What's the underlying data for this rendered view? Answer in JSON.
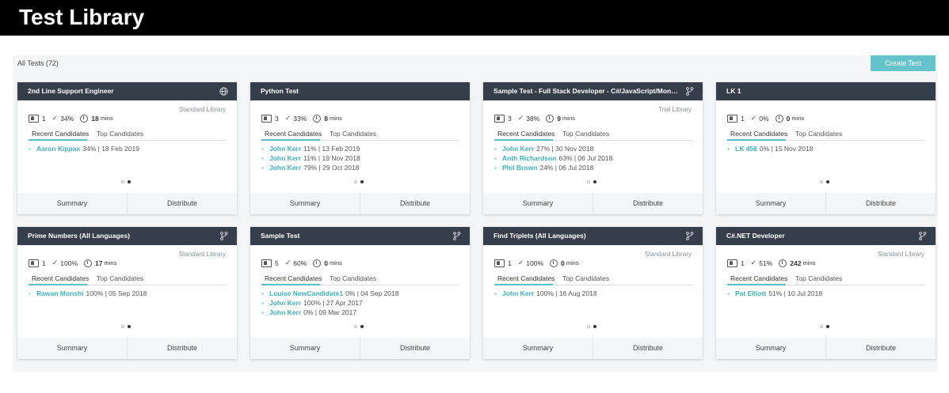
{
  "page": {
    "title": "Test Library"
  },
  "toolbar": {
    "all_tests": "All Tests (72)",
    "create_label": "Create Test"
  },
  "card_labels": {
    "recent": "Recent Candidates",
    "top": "Top Candidates",
    "summary": "Summary",
    "distribute": "Distribute",
    "mins_unit": "mins"
  },
  "cards": [
    {
      "title": "2nd Line Support Engineer",
      "icon": "globe-icon",
      "library": "Standard Library",
      "candidates_count": "1",
      "score": "34%",
      "duration": "18",
      "recent": [
        {
          "name": "Aaron Kippax",
          "detail": "34% | 18 Feb 2019"
        }
      ]
    },
    {
      "title": "Python Test",
      "icon": "",
      "library": "",
      "candidates_count": "3",
      "score": "33%",
      "duration": "8",
      "recent": [
        {
          "name": "John Kerr",
          "detail": "11% | 13 Feb 2019"
        },
        {
          "name": "John Kerr",
          "detail": "11% | 19 Nov 2018"
        },
        {
          "name": "John Kerr",
          "detail": "79% | 29 Oct 2018"
        }
      ]
    },
    {
      "title": "Sample Test - Full Stack Developer - C#/JavaScript/Mongo...",
      "icon": "fork-icon",
      "library": "Trial Library",
      "candidates_count": "3",
      "score": "38%",
      "duration": "9",
      "recent": [
        {
          "name": "John Kerr",
          "detail": "27% | 30 Nov 2018"
        },
        {
          "name": "Anth Richardson",
          "detail": "63% | 06 Jul 2018"
        },
        {
          "name": "Phil Brown",
          "detail": "24% | 06 Jul 2018"
        }
      ]
    },
    {
      "title": "LK 1",
      "icon": "",
      "library": "",
      "candidates_count": "1",
      "score": "0%",
      "duration": "0",
      "recent": [
        {
          "name": "LK 456",
          "detail": "0% | 15 Nov 2018"
        }
      ]
    },
    {
      "title": "Prime Numbers (All Languages)",
      "icon": "fork-icon",
      "library": "Standard Library",
      "candidates_count": "1",
      "score": "100%",
      "duration": "17",
      "recent": [
        {
          "name": "Rawan Monshi",
          "detail": "100% | 05 Sep 2018"
        }
      ]
    },
    {
      "title": "Sample Test",
      "icon": "fork-icon",
      "library": "",
      "candidates_count": "5",
      "score": "60%",
      "duration": "0",
      "recent": [
        {
          "name": "Louise NewCandidate1",
          "detail": "0% | 04 Sep 2018"
        },
        {
          "name": "John Kerr",
          "detail": "100% | 27 Apr 2017"
        },
        {
          "name": "John Kerr",
          "detail": "0% | 09 Mar 2017"
        }
      ]
    },
    {
      "title": "Find Triplets (All Languages)",
      "icon": "fork-icon",
      "library": "Standard Library",
      "candidates_count": "1",
      "score": "100%",
      "duration": "0",
      "recent": [
        {
          "name": "John Kerr",
          "detail": "100% | 16 Aug 2018"
        }
      ]
    },
    {
      "title": "C#.NET Developer",
      "icon": "fork-icon",
      "library": "Standard Library",
      "candidates_count": "1",
      "score": "51%",
      "duration": "242",
      "recent": [
        {
          "name": "Pat Elliott",
          "detail": "51% | 10 Jul 2018"
        }
      ]
    }
  ]
}
